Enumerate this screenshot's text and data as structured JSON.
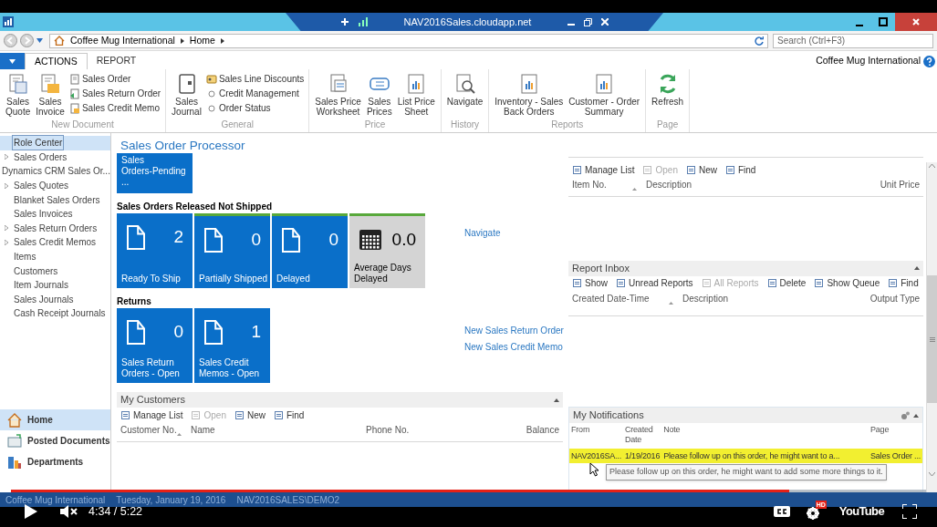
{
  "window": {
    "title": "NAV2016Sales.cloudapp.net"
  },
  "address_bar": {
    "breadcrumb": [
      "Coffee Mug International",
      "Home"
    ],
    "search": {
      "placeholder": "Search (Ctrl+F3)"
    }
  },
  "ribbon": {
    "tabs": [
      {
        "label": "ACTIONS",
        "selected": true
      },
      {
        "label": "REPORT",
        "selected": false
      }
    ],
    "company": "Coffee Mug International",
    "groups": [
      {
        "name": "New Document",
        "large": [
          "Sales\nQuote",
          "Sales\nInvoice"
        ],
        "small": [
          "Sales Order",
          "Sales Return Order",
          "Sales Credit Memo"
        ]
      },
      {
        "name": "General",
        "large": [
          "Sales\nJournal"
        ],
        "small": [
          "Sales Line Discounts",
          "Credit Management",
          "Order Status"
        ]
      },
      {
        "name": "Price",
        "large": [
          "Sales Price\nWorksheet",
          "Sales\nPrices",
          "List Price\nSheet"
        ]
      },
      {
        "name": "History",
        "large": [
          "Navigate"
        ]
      },
      {
        "name": "Reports",
        "large": [
          "Inventory - Sales\nBack Orders",
          "Customer - Order\nSummary"
        ]
      },
      {
        "name": "Page",
        "large": [
          "Refresh"
        ]
      }
    ]
  },
  "sidebar": {
    "items": [
      {
        "label": "Role Center",
        "collapsible": false,
        "selected": true
      },
      {
        "label": "Sales Orders",
        "collapsible": true,
        "selected": false
      },
      {
        "label": "Dynamics CRM Sales Or...",
        "collapsible": false,
        "selected": false
      },
      {
        "label": "Sales Quotes",
        "collapsible": true,
        "selected": false
      },
      {
        "label": "Blanket Sales Orders",
        "collapsible": false,
        "selected": false
      },
      {
        "label": "Sales Invoices",
        "collapsible": false,
        "selected": false
      },
      {
        "label": "Sales Return Orders",
        "collapsible": true,
        "selected": false
      },
      {
        "label": "Sales Credit Memos",
        "collapsible": true,
        "selected": false
      },
      {
        "label": "Items",
        "collapsible": false,
        "selected": false
      },
      {
        "label": "Customers",
        "collapsible": false,
        "selected": false
      },
      {
        "label": "Item Journals",
        "collapsible": false,
        "selected": false
      },
      {
        "label": "Sales Journals",
        "collapsible": false,
        "selected": false
      },
      {
        "label": "Cash Receipt Journals",
        "collapsible": false,
        "selected": false
      }
    ],
    "nav_buttons": [
      {
        "label": "Home",
        "selected": true
      },
      {
        "label": "Posted Documents",
        "selected": false
      },
      {
        "label": "Departments",
        "selected": false
      }
    ]
  },
  "page_title": "Sales Order Processor",
  "cue_groups": [
    {
      "tiles": [
        {
          "kind": "count",
          "label": "Sales\nOrders-Pending ...",
          "indicator": false
        }
      ]
    },
    {
      "title": "Sales Orders Released Not Shipped",
      "tiles": [
        {
          "kind": "count",
          "value": "2",
          "label": "Ready To Ship",
          "indicator": false
        },
        {
          "kind": "count",
          "value": "0",
          "label": "Partially Shipped",
          "indicator": true
        },
        {
          "kind": "count",
          "value": "0",
          "label": "Delayed",
          "indicator": true
        },
        {
          "kind": "average",
          "value": "0.0",
          "label": "Average Days\nDelayed",
          "indicator": true
        }
      ],
      "actions": [
        "Navigate"
      ]
    },
    {
      "title": "Returns",
      "tiles": [
        {
          "kind": "count",
          "value": "0",
          "label": "Sales Return\nOrders - Open",
          "indicator": false
        },
        {
          "kind": "count",
          "value": "1",
          "label": "Sales Credit\nMemos - Open",
          "indicator": false
        }
      ],
      "actions": [
        "New Sales Return Order",
        "New Sales Credit Memo"
      ]
    }
  ],
  "my_customers": {
    "title": "My Customers",
    "toolbar": [
      {
        "label": "Manage List",
        "disabled": false
      },
      {
        "label": "Open",
        "disabled": true
      },
      {
        "label": "New",
        "disabled": false
      },
      {
        "label": "Find",
        "disabled": false
      }
    ],
    "columns": [
      "Customer No.",
      "Name",
      "Phone No.",
      "Balance"
    ]
  },
  "my_items": {
    "toolbar": [
      {
        "label": "Manage List",
        "disabled": false
      },
      {
        "label": "Open",
        "disabled": true
      },
      {
        "label": "New",
        "disabled": false
      },
      {
        "label": "Find",
        "disabled": false
      }
    ],
    "columns": [
      "Item No.",
      "Description",
      "Unit Price"
    ]
  },
  "report_inbox": {
    "title": "Report Inbox",
    "toolbar": [
      {
        "label": "Show",
        "disabled": false
      },
      {
        "label": "Unread Reports",
        "disabled": false
      },
      {
        "label": "All Reports",
        "disabled": true
      },
      {
        "label": "Delete",
        "disabled": false
      },
      {
        "label": "Show Queue",
        "disabled": false
      },
      {
        "label": "Find",
        "disabled": false
      }
    ],
    "columns": [
      "Created Date-Time",
      "Description",
      "Output Type"
    ]
  },
  "my_notifications": {
    "title": "My Notifications",
    "columns": [
      "From",
      "Created\nDate",
      "Note",
      "Page"
    ],
    "rows": [
      {
        "cells": [
          "NAV2016SA...",
          "1/19/2016",
          "Please follow up on this order, he might want to a...",
          "Sales Order ..."
        ],
        "selected": true
      }
    ],
    "tooltip": "Please follow up on this order, he might want to add some more things to it."
  },
  "status_bar": [
    "Coffee Mug International",
    "Tuesday, January 19, 2016",
    "NAV2016SALES\\DEMO2"
  ],
  "video_player": {
    "progress": {
      "level": 0.85
    },
    "time": "4:34 / 5:22",
    "hd_badge": "HD",
    "logo": "YouTube"
  }
}
